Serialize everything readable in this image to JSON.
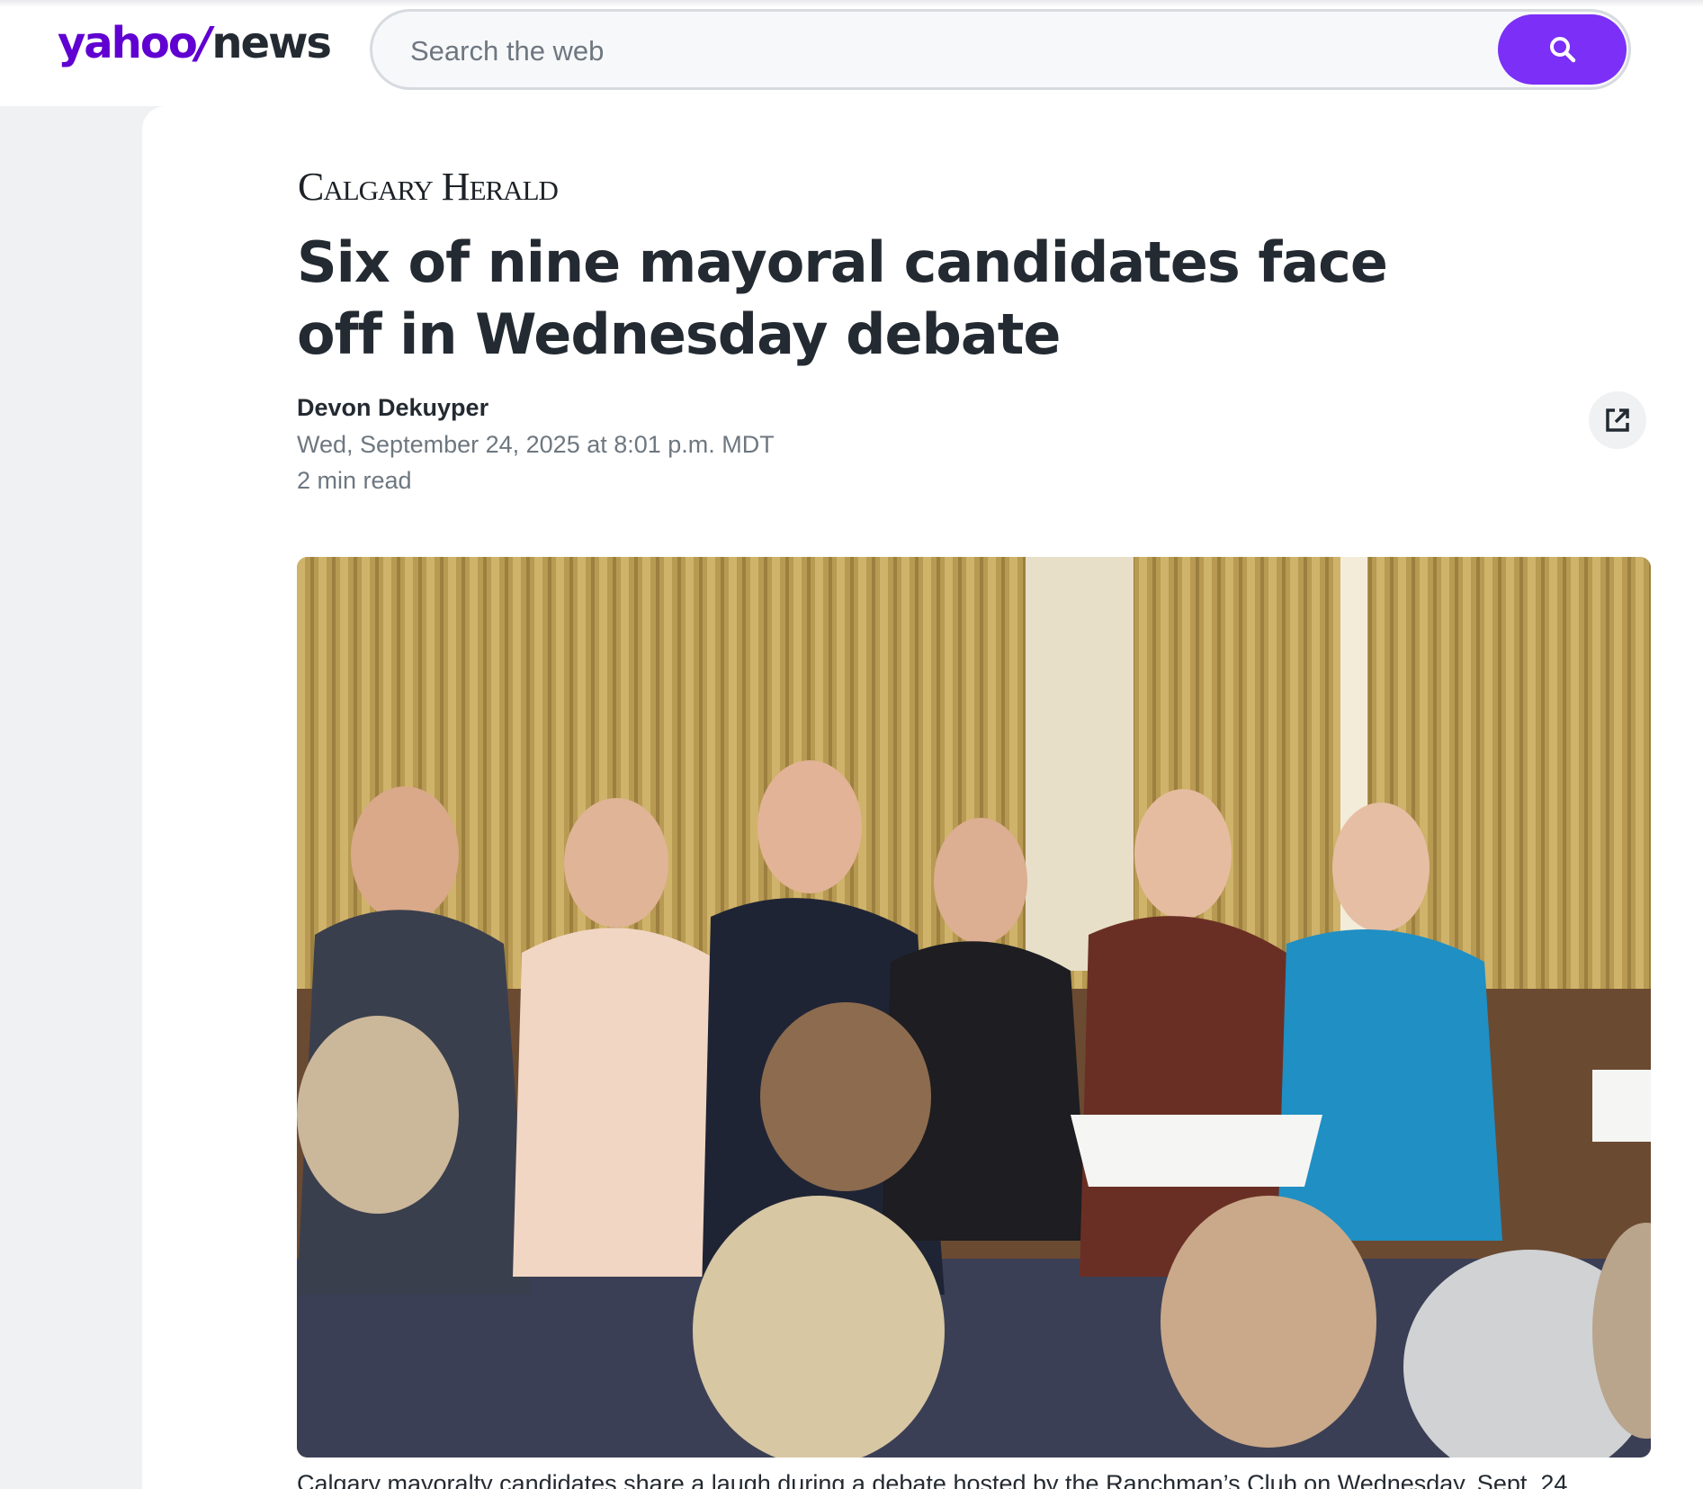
{
  "header": {
    "logo": {
      "yahoo": "yahoo",
      "slash": "/",
      "news": "news"
    },
    "search": {
      "placeholder": "Search the web",
      "value": "",
      "button_icon": "search-icon"
    }
  },
  "article": {
    "publisher": "Calgary Herald",
    "headline": "Six of nine mayoral candidates face off in Wednesday debate",
    "author": "Devon Dekuyper",
    "date": "Wed, September 24, 2025 at 8:01 p.m. MDT",
    "read_time": "2 min read",
    "share_icon": "external-link-icon",
    "caption": "Calgary mayoralty candidates share a laugh during a debate hosted by the Ranchman’s Club on Wednesday, Sept. 24"
  },
  "colors": {
    "brand_purple": "#6001d2",
    "search_button": "#7b2ff7",
    "text_dark": "#232a31",
    "text_muted": "#6e7780",
    "page_bg": "#f0f1f3"
  }
}
